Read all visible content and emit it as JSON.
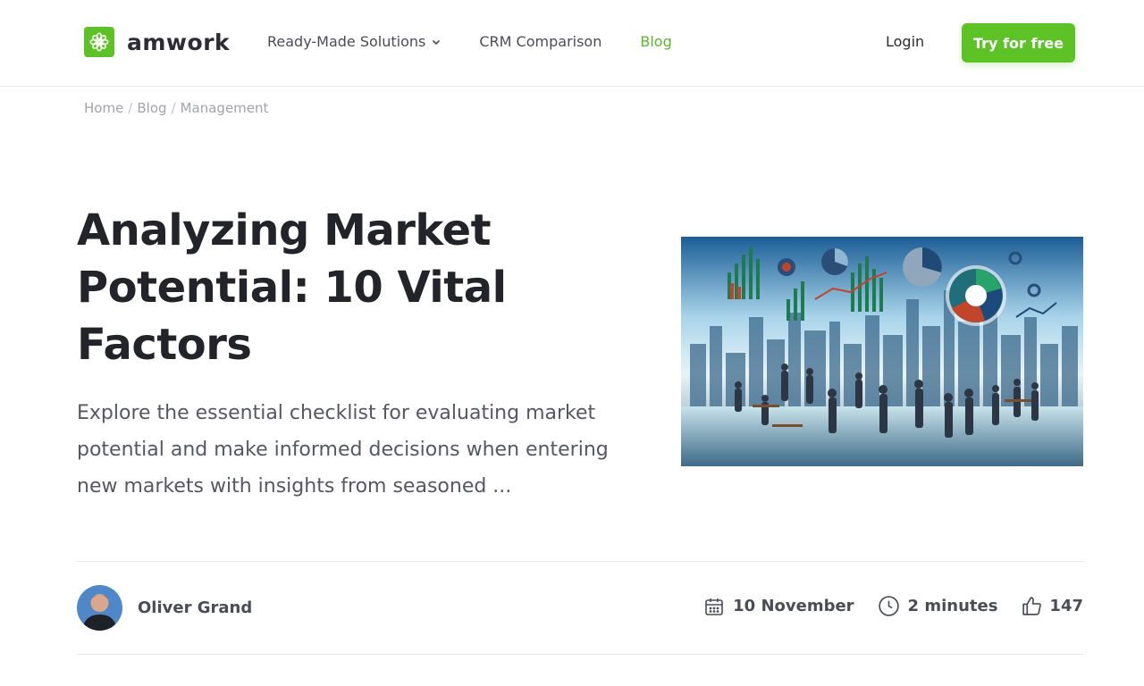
{
  "header": {
    "logo_text": "amwork",
    "nav": [
      {
        "label": "Ready-Made Solutions",
        "has_dropdown": true
      },
      {
        "label": "CRM Comparison"
      },
      {
        "label": "Blog",
        "active": true
      }
    ],
    "login_label": "Login",
    "cta_label": "Try for free"
  },
  "breadcrumb": [
    "Home",
    "Blog",
    "Management"
  ],
  "article": {
    "title": "Analyzing Market Potential: 10 Vital Factors",
    "excerpt": "Explore the essential checklist for evaluating market potential and make informed decisions when entering new markets with insights from seasoned ...",
    "author": "Oliver Grand",
    "date": "10 November",
    "read_time": "2 minutes",
    "likes": "147"
  },
  "colors": {
    "brand_green": "#5cc226",
    "active_nav": "#5cb82a",
    "text_dark": "#22242a"
  },
  "icons": [
    "logo-flower-icon",
    "chevron-down-icon",
    "calendar-icon",
    "clock-icon",
    "thumbs-up-icon"
  ]
}
